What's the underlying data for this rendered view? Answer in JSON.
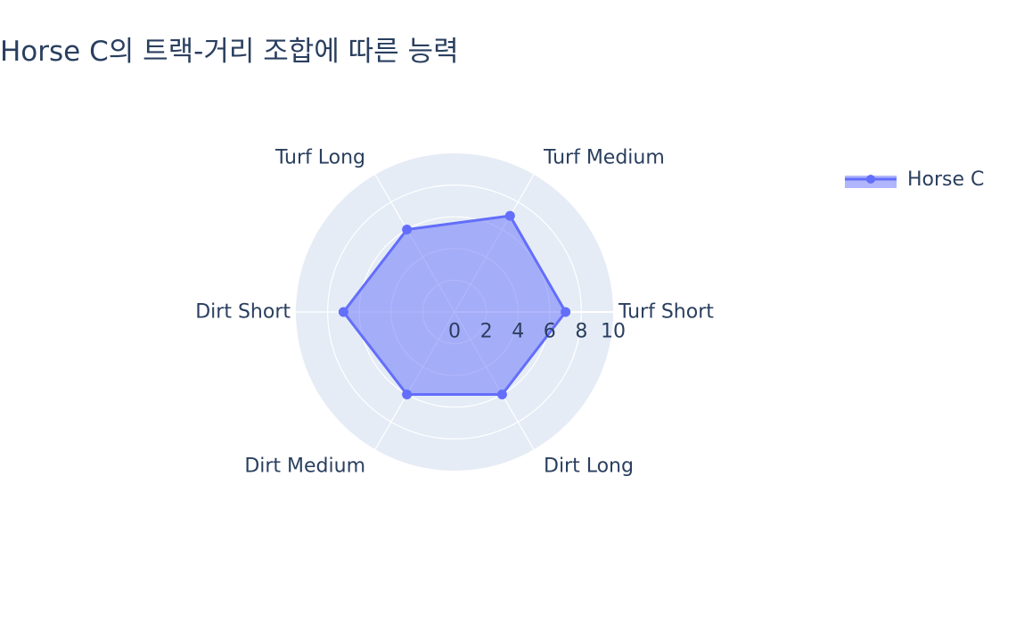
{
  "colors": {
    "series": "#636efa",
    "fill": "rgba(99,110,250,0.5)",
    "polar_bg": "#e5ecf6",
    "grid": "#ffffff",
    "text": "#2a3f5f"
  },
  "chart_data": {
    "type": "radar",
    "title": "Horse C의 트랙-거리 조합에 따른 능력",
    "categories": [
      "Turf Short",
      "Turf Medium",
      "Turf Long",
      "Dirt Short",
      "Dirt Medium",
      "Dirt Long"
    ],
    "series": [
      {
        "name": "Horse C",
        "values": [
          7,
          7,
          6,
          7,
          6,
          6
        ],
        "fill": "toself"
      }
    ],
    "radial_range": [
      0,
      10
    ],
    "radial_ticks": [
      "0",
      "2",
      "4",
      "6",
      "8",
      "10"
    ],
    "grid": true,
    "legend_position": "top-right"
  }
}
